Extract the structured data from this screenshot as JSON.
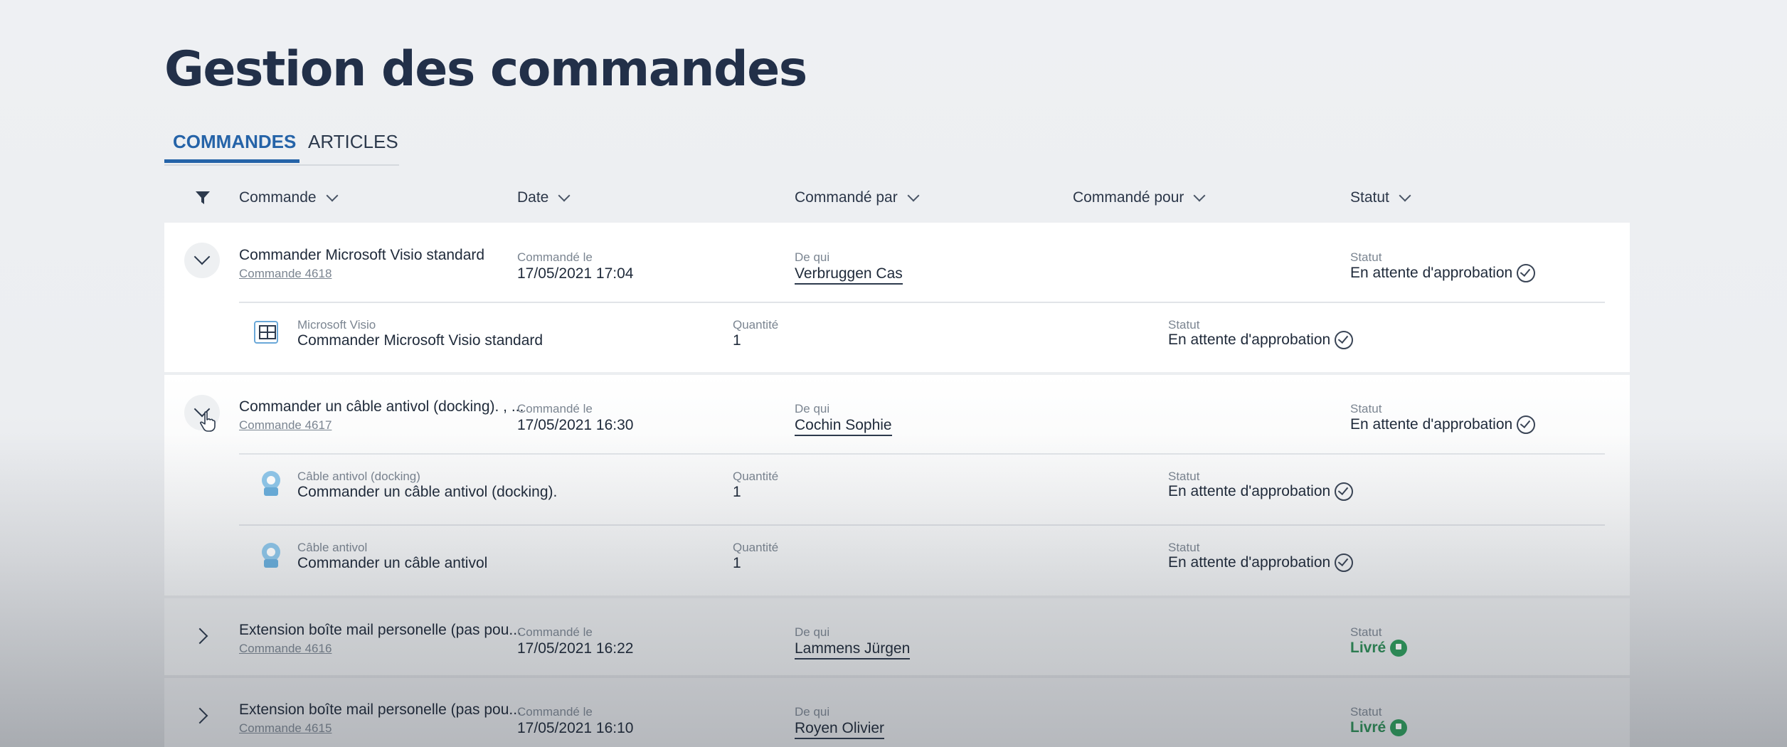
{
  "page": {
    "title": "Gestion des commandes"
  },
  "tabs": [
    {
      "label": "COMMANDES",
      "active": true
    },
    {
      "label": "ARTICLES",
      "active": false
    }
  ],
  "columns": {
    "commande": "Commande",
    "date": "Date",
    "commande_par": "Commandé par",
    "commande_pour": "Commandé pour",
    "statut": "Statut"
  },
  "labels": {
    "date": "Commandé le",
    "by": "De qui",
    "status": "Statut",
    "qty": "Quantité"
  },
  "colors": {
    "accent": "#2563a8",
    "delivered": "#2e8b57"
  },
  "orders": [
    {
      "title": "Commander Microsoft Visio standard",
      "number": "Commande 4618",
      "date": "17/05/2021 17:04",
      "by": "Verbruggen Cas",
      "status": "En attente d'approbation",
      "status_icon": "check-circle-icon",
      "expanded": true,
      "items": [
        {
          "category": "Microsoft Visio",
          "name": "Commander Microsoft Visio standard",
          "qty": "1",
          "status": "En attente d'approbation",
          "icon": "visio-icon"
        }
      ]
    },
    {
      "title": "Commander un câble antivol (docking). , ...",
      "number": "Commande 4617",
      "date": "17/05/2021 16:30",
      "by": "Cochin Sophie",
      "status": "En attente d'approbation",
      "status_icon": "check-circle-icon",
      "expanded": true,
      "items": [
        {
          "category": "Câble antivol (docking)",
          "name": "Commander un câble antivol (docking).",
          "qty": "1",
          "status": "En attente d'approbation",
          "icon": "lock-cable-icon"
        },
        {
          "category": "Câble antivol",
          "name": "Commander un câble antivol",
          "qty": "1",
          "status": "En attente d'approbation",
          "icon": "lock-cable-icon"
        }
      ]
    },
    {
      "title": "Extension boîte mail personelle (pas pou...",
      "number": "Commande 4616",
      "date": "17/05/2021 16:22",
      "by": "Lammens Jürgen",
      "status": "Livré",
      "status_icon": "flag-circle-icon",
      "expanded": false,
      "items": []
    },
    {
      "title": "Extension boîte mail personelle (pas pou...",
      "number": "Commande 4615",
      "date": "17/05/2021 16:10",
      "by": "Royen Olivier",
      "status": "Livré",
      "status_icon": "flag-circle-icon",
      "expanded": false,
      "items": []
    }
  ]
}
